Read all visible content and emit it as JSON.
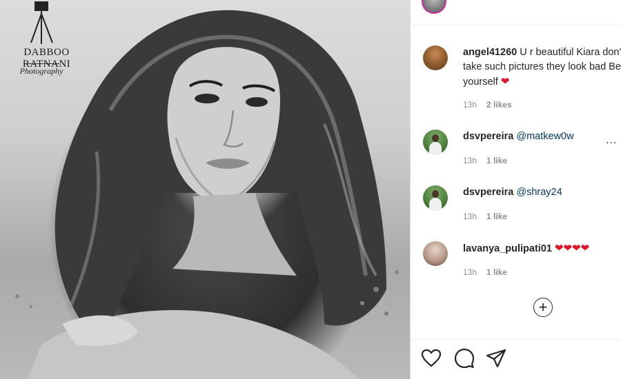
{
  "watermark": {
    "name": "DABBOO RATNANI",
    "subtitle": "Photography"
  },
  "comments": [
    {
      "username": "angel41260",
      "text": "U r beautiful Kiara don't take such pictures they look bad Be yourself",
      "emoji": "❤",
      "time": "13h",
      "likes": "2 likes"
    },
    {
      "username": "dsvpereira",
      "mention": "@matkew0w",
      "time": "13h",
      "likes": "1 like",
      "more": "..."
    },
    {
      "username": "dsvpereira",
      "mention": "@shray24",
      "time": "13h",
      "likes": "1 like"
    },
    {
      "username": "lavanya_pulipati01",
      "emoji": "❤❤❤❤",
      "time": "13h",
      "likes": "1 like"
    }
  ],
  "load_more": "+",
  "actions": [
    "heart-icon",
    "comment-icon",
    "share-icon"
  ],
  "colors": {
    "mention": "#00376b",
    "heart": "#e0142a",
    "meta": "#8e8e8e"
  }
}
